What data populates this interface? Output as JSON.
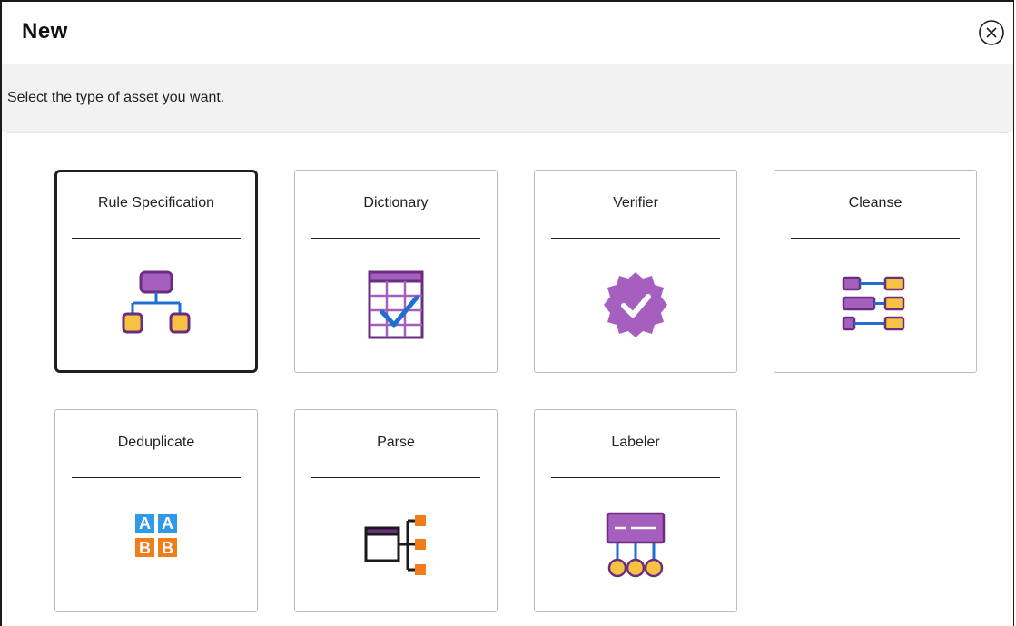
{
  "dialog": {
    "title": "New",
    "subtitle": "Select the type of asset you want."
  },
  "icons": {
    "close": "close-circle-icon"
  },
  "colors": {
    "purple": "#a55fbf",
    "purple_dark": "#6b2d7f",
    "gold": "#f5c242",
    "blue": "#1f6fd1",
    "orange": "#f07d1a",
    "light_blue": "#2f9ae8"
  },
  "assets": [
    {
      "label": "Rule Specification",
      "icon": "rule-specification-icon",
      "selected": true
    },
    {
      "label": "Dictionary",
      "icon": "dictionary-icon",
      "selected": false
    },
    {
      "label": "Verifier",
      "icon": "verifier-icon",
      "selected": false
    },
    {
      "label": "Cleanse",
      "icon": "cleanse-icon",
      "selected": false
    },
    {
      "label": "Deduplicate",
      "icon": "deduplicate-icon",
      "selected": false
    },
    {
      "label": "Parse",
      "icon": "parse-icon",
      "selected": false
    },
    {
      "label": "Labeler",
      "icon": "labeler-icon",
      "selected": false
    }
  ]
}
